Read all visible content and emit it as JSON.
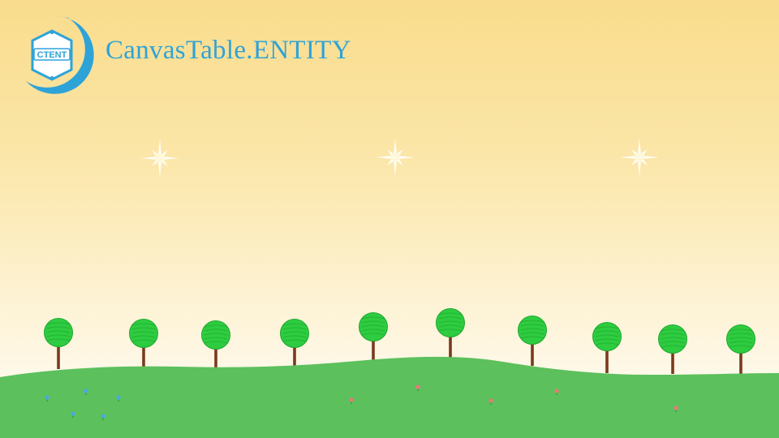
{
  "brand": {
    "title": "CanvasTable.ENTITY",
    "logo_text": "CTENT",
    "logo_color": "#2ea3d8"
  },
  "scene": {
    "sky_top_color": "#f9dc8c",
    "sky_bottom_color": "#fef8e8",
    "ground_color": "#5cc05c",
    "tree_crown_color": "#2ecc40",
    "tree_trunk_color": "#7a3a1e",
    "star_color": "#ffffff",
    "flower_colors": [
      "#4aa8e0",
      "#e87a7a"
    ],
    "stars": 3,
    "trees": 10
  }
}
